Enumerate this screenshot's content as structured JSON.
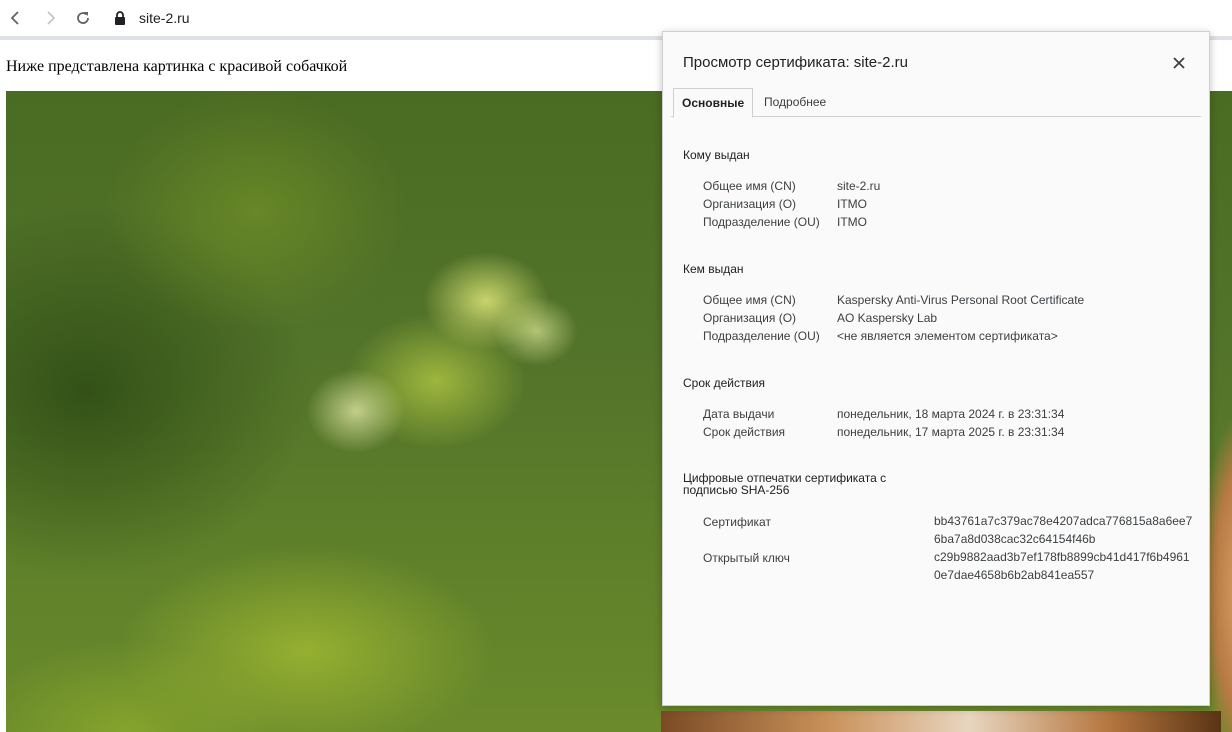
{
  "browser": {
    "url": "site-2.ru"
  },
  "page": {
    "intro_text": "Ниже представлена картинка с красивой собачкой"
  },
  "dialog": {
    "title": "Просмотр сертификата: site-2.ru",
    "tabs": [
      {
        "label": "Основные",
        "active": true
      },
      {
        "label": "Подробнее",
        "active": false
      }
    ],
    "issued_to": {
      "heading": "Кому выдан",
      "rows": [
        {
          "label": "Общее имя (CN)",
          "value": "site-2.ru"
        },
        {
          "label": "Организация (O)",
          "value": "ITMO"
        },
        {
          "label": "Подразделение (OU)",
          "value": "ITMO"
        }
      ]
    },
    "issued_by": {
      "heading": "Кем выдан",
      "rows": [
        {
          "label": "Общее имя (CN)",
          "value": "Kaspersky Anti-Virus Personal Root Certificate"
        },
        {
          "label": "Организация (O)",
          "value": "AO Kaspersky Lab"
        },
        {
          "label": "Подразделение (OU)",
          "value": "<не является элементом сертификата>"
        }
      ]
    },
    "validity": {
      "heading": "Срок действия",
      "rows": [
        {
          "label": "Дата выдачи",
          "value": "понедельник, 18 марта 2024 г. в 23:31:34"
        },
        {
          "label": "Срок действия",
          "value": "понедельник, 17 марта 2025 г. в 23:31:34"
        }
      ]
    },
    "fingerprints": {
      "heading_line1": "Цифровые отпечатки сертификата с",
      "heading_line2": "подписью SHA-256",
      "rows": [
        {
          "label": "Сертификат",
          "value_line1": "bb43761a7c379ac78e4207adca776815a8a6ee7",
          "value_line2": "6ba7a8d038cac32c64154f46b"
        },
        {
          "label": "Открытый ключ",
          "value_line1": "c29b9882aad3b7ef178fb8899cb41d417f6b4961",
          "value_line2": "0e7dae4658b6b2ab841ea557"
        }
      ]
    }
  }
}
